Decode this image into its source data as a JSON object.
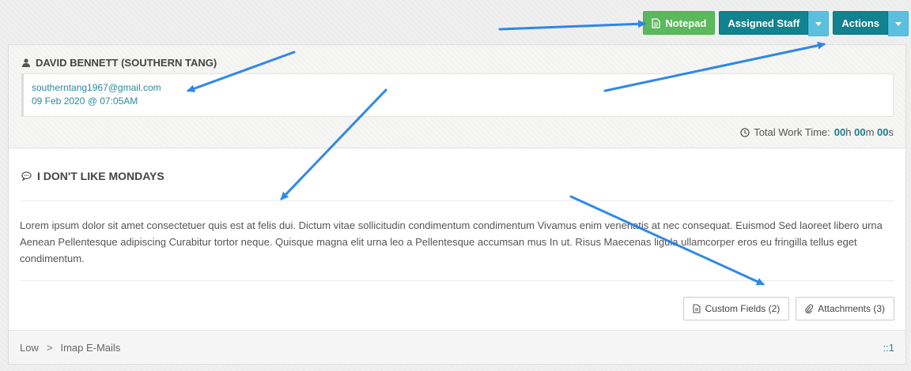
{
  "toolbar": {
    "notepad_label": "Notepad",
    "assigned_staff_label": "Assigned Staff",
    "actions_label": "Actions"
  },
  "ticket": {
    "person": "DAVID BENNETT (SOUTHERN TANG)",
    "email": "southerntang1967@gmail.com",
    "date": "09 Feb 2020 @ 07:05AM",
    "work_time": {
      "label": "Total Work Time:",
      "hours": "00",
      "hours_unit": "h",
      "minutes": "00",
      "minutes_unit": "m",
      "seconds": "00",
      "seconds_unit": "s"
    },
    "subject": "I DON'T LIKE MONDAYS",
    "body": "Lorem ipsum dolor sit amet consectetuer quis est at felis dui. Dictum vitae sollicitudin condimentum condimentum Vivamus enim venenatis at nec consequat. Euismod Sed laoreet libero urna Aenean Pellentesque adipiscing Curabitur tortor neque. Quisque magna elit urna leo a Pellentesque accumsan mus In ut. Risus Maecenas ligula ullamcorper eros eu fringilla tellus eget condimentum.",
    "custom_fields_label": "Custom Fields (2)",
    "attachments_label": "Attachments (3)"
  },
  "footer": {
    "priority": "Low",
    "separator": ">",
    "department": "Imap E-Mails",
    "ref": "::1"
  },
  "colors": {
    "green": "#5cb85c",
    "teal": "#12828f",
    "light_blue": "#5bc0de",
    "link": "#2a8a9b",
    "annotation_arrow": "#1e7ee8"
  },
  "icons": [
    "note-icon",
    "caret-down-icon",
    "user-icon",
    "clock-icon",
    "speech-bubble-icon",
    "document-icon",
    "paperclip-icon"
  ]
}
